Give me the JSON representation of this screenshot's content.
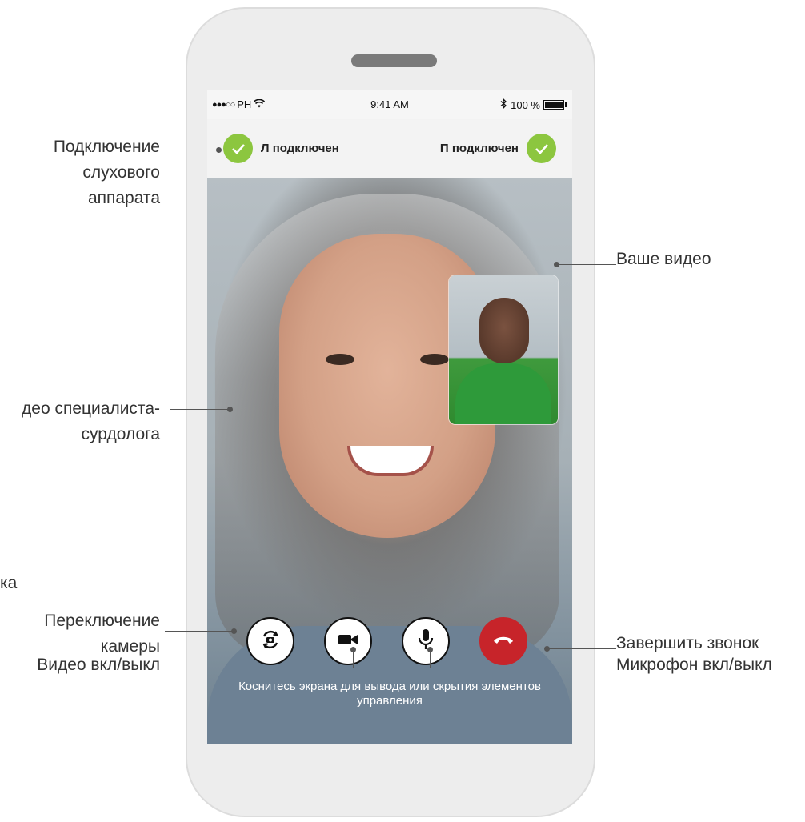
{
  "status_bar": {
    "signal": "●●●○○",
    "carrier": "PH",
    "time": "9:41 AM",
    "battery": "100 %"
  },
  "connection": {
    "left_label": "Л подключен",
    "right_label": "П подключен"
  },
  "controls": {
    "switch_camera": "Переключение камеры",
    "video_toggle": "Видео вкл/выкл",
    "mic_toggle": "Микрофон вкл/выкл",
    "end_call": "Завершить звонок"
  },
  "hint": "Коснитесь экрана для вывода или скрытия элементов управления",
  "callouts": {
    "hearing_aid_connection": [
      "Подключение",
      "слухового",
      "аппарата"
    ],
    "your_video": "Ваше видео",
    "specialist_video": [
      "деo специалиста-",
      "сурдолога"
    ],
    "cut_off": "ка",
    "switch_camera": [
      "Переключение",
      "камеры"
    ],
    "video_toggle": "Видео вкл/выкл",
    "end_call": "Завершить звонок",
    "mic_toggle": "Микрофон вкл/выкл"
  },
  "colors": {
    "check_green": "#8cc63f",
    "end_call_red": "#c7242a"
  }
}
